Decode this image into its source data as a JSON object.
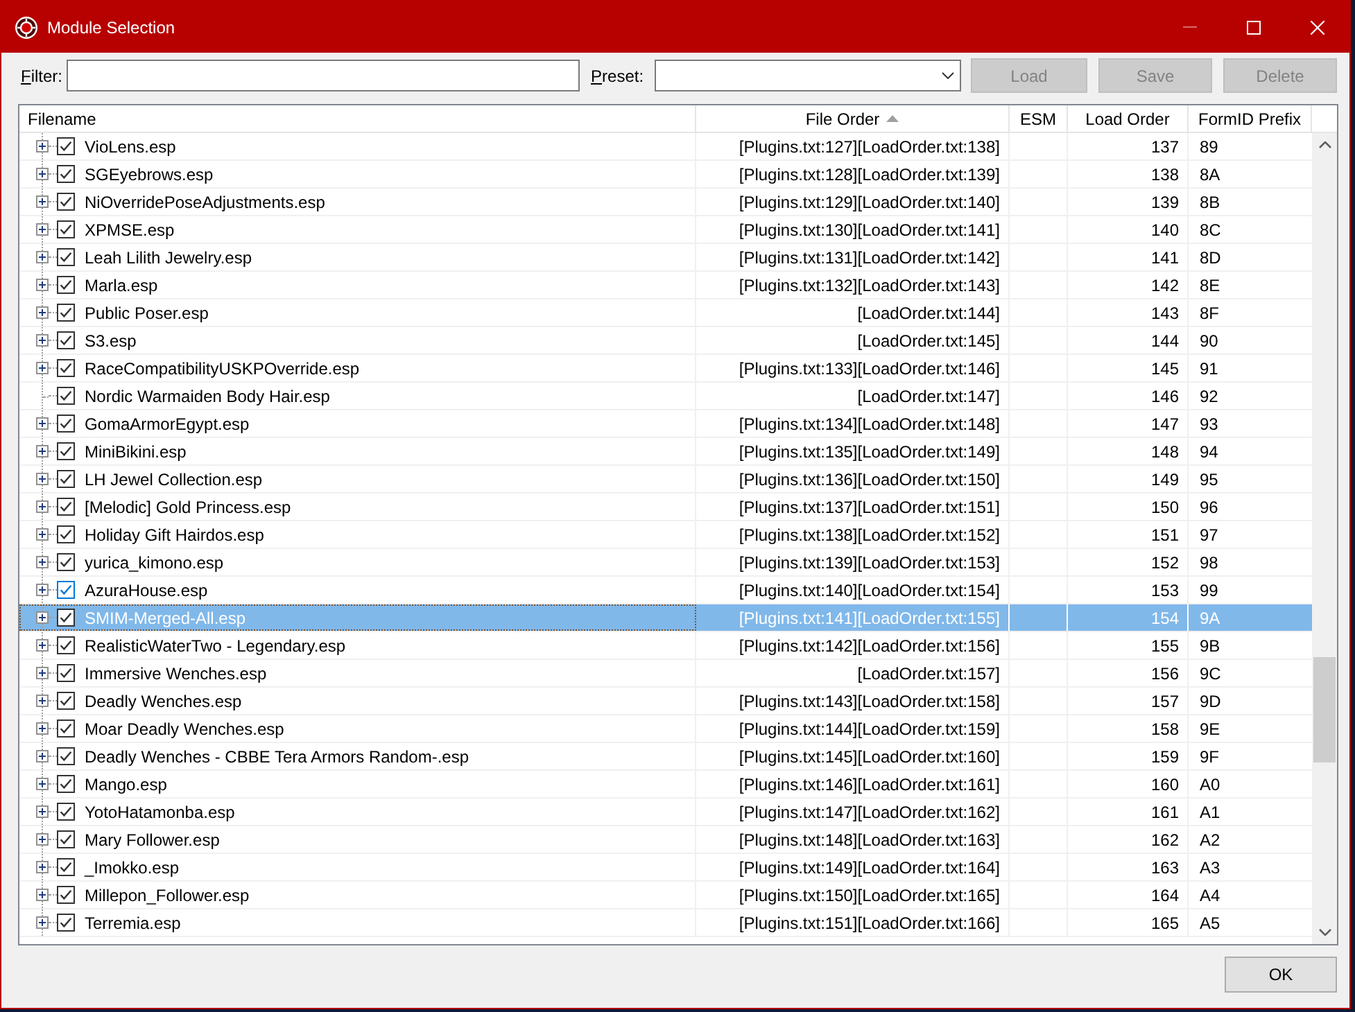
{
  "window": {
    "title": "Module Selection",
    "minimize_disabled": true
  },
  "filter": {
    "label": "Filter:"
  },
  "preset": {
    "label": "Preset:"
  },
  "buttons": [
    {
      "label": "Load",
      "disabled": true
    },
    {
      "label": "Save",
      "disabled": true
    },
    {
      "label": "Delete",
      "disabled": true
    }
  ],
  "table": {
    "columns": [
      {
        "label": "Filename",
        "sorted": false
      },
      {
        "label": "File Order",
        "sorted": true
      },
      {
        "label": "ESM",
        "sorted": false
      },
      {
        "label": "Load Order",
        "sorted": false
      },
      {
        "label": "FormID Prefix",
        "sorted": false
      }
    ],
    "rows": [
      {
        "filename": "VioLens.esp",
        "file_order": "[Plugins.txt:127][LoadOrder.txt:138]",
        "load_order": "137",
        "formid_prefix": "89",
        "checked": true,
        "expandable": true,
        "selected": false,
        "hovered": false
      },
      {
        "filename": "SGEyebrows.esp",
        "file_order": "[Plugins.txt:128][LoadOrder.txt:139]",
        "load_order": "138",
        "formid_prefix": "8A",
        "checked": true,
        "expandable": true,
        "selected": false,
        "hovered": false
      },
      {
        "filename": "NiOverridePoseAdjustments.esp",
        "file_order": "[Plugins.txt:129][LoadOrder.txt:140]",
        "load_order": "139",
        "formid_prefix": "8B",
        "checked": true,
        "expandable": true,
        "selected": false,
        "hovered": false
      },
      {
        "filename": "XPMSE.esp",
        "file_order": "[Plugins.txt:130][LoadOrder.txt:141]",
        "load_order": "140",
        "formid_prefix": "8C",
        "checked": true,
        "expandable": true,
        "selected": false,
        "hovered": false
      },
      {
        "filename": "Leah Lilith Jewelry.esp",
        "file_order": "[Plugins.txt:131][LoadOrder.txt:142]",
        "load_order": "141",
        "formid_prefix": "8D",
        "checked": true,
        "expandable": true,
        "selected": false,
        "hovered": false
      },
      {
        "filename": "Marla.esp",
        "file_order": "[Plugins.txt:132][LoadOrder.txt:143]",
        "load_order": "142",
        "formid_prefix": "8E",
        "checked": true,
        "expandable": true,
        "selected": false,
        "hovered": false
      },
      {
        "filename": "Public Poser.esp",
        "file_order": "[LoadOrder.txt:144]",
        "load_order": "143",
        "formid_prefix": "8F",
        "checked": true,
        "expandable": true,
        "selected": false,
        "hovered": false
      },
      {
        "filename": "S3.esp",
        "file_order": "[LoadOrder.txt:145]",
        "load_order": "144",
        "formid_prefix": "90",
        "checked": true,
        "expandable": true,
        "selected": false,
        "hovered": false
      },
      {
        "filename": "RaceCompatibilityUSKPOverride.esp",
        "file_order": "[Plugins.txt:133][LoadOrder.txt:146]",
        "load_order": "145",
        "formid_prefix": "91",
        "checked": true,
        "expandable": true,
        "selected": false,
        "hovered": false
      },
      {
        "filename": "Nordic Warmaiden Body Hair.esp",
        "file_order": "[LoadOrder.txt:147]",
        "load_order": "146",
        "formid_prefix": "92",
        "checked": true,
        "expandable": false,
        "selected": false,
        "hovered": false
      },
      {
        "filename": "GomaArmorEgypt.esp",
        "file_order": "[Plugins.txt:134][LoadOrder.txt:148]",
        "load_order": "147",
        "formid_prefix": "93",
        "checked": true,
        "expandable": true,
        "selected": false,
        "hovered": false
      },
      {
        "filename": "MiniBikini.esp",
        "file_order": "[Plugins.txt:135][LoadOrder.txt:149]",
        "load_order": "148",
        "formid_prefix": "94",
        "checked": true,
        "expandable": true,
        "selected": false,
        "hovered": false
      },
      {
        "filename": "LH Jewel Collection.esp",
        "file_order": "[Plugins.txt:136][LoadOrder.txt:150]",
        "load_order": "149",
        "formid_prefix": "95",
        "checked": true,
        "expandable": true,
        "selected": false,
        "hovered": false
      },
      {
        "filename": "[Melodic] Gold Princess.esp",
        "file_order": "[Plugins.txt:137][LoadOrder.txt:151]",
        "load_order": "150",
        "formid_prefix": "96",
        "checked": true,
        "expandable": true,
        "selected": false,
        "hovered": false
      },
      {
        "filename": "Holiday Gift Hairdos.esp",
        "file_order": "[Plugins.txt:138][LoadOrder.txt:152]",
        "load_order": "151",
        "formid_prefix": "97",
        "checked": true,
        "expandable": true,
        "selected": false,
        "hovered": false
      },
      {
        "filename": "yurica_kimono.esp",
        "file_order": "[Plugins.txt:139][LoadOrder.txt:153]",
        "load_order": "152",
        "formid_prefix": "98",
        "checked": true,
        "expandable": true,
        "selected": false,
        "hovered": false
      },
      {
        "filename": "AzuraHouse.esp",
        "file_order": "[Plugins.txt:140][LoadOrder.txt:154]",
        "load_order": "153",
        "formid_prefix": "99",
        "checked": true,
        "expandable": true,
        "selected": false,
        "hovered": true
      },
      {
        "filename": "SMIM-Merged-All.esp",
        "file_order": "[Plugins.txt:141][LoadOrder.txt:155]",
        "load_order": "154",
        "formid_prefix": "9A",
        "checked": true,
        "expandable": true,
        "selected": true,
        "hovered": false
      },
      {
        "filename": "RealisticWaterTwo - Legendary.esp",
        "file_order": "[Plugins.txt:142][LoadOrder.txt:156]",
        "load_order": "155",
        "formid_prefix": "9B",
        "checked": true,
        "expandable": true,
        "selected": false,
        "hovered": false
      },
      {
        "filename": "Immersive Wenches.esp",
        "file_order": "[LoadOrder.txt:157]",
        "load_order": "156",
        "formid_prefix": "9C",
        "checked": true,
        "expandable": true,
        "selected": false,
        "hovered": false
      },
      {
        "filename": "Deadly Wenches.esp",
        "file_order": "[Plugins.txt:143][LoadOrder.txt:158]",
        "load_order": "157",
        "formid_prefix": "9D",
        "checked": true,
        "expandable": true,
        "selected": false,
        "hovered": false
      },
      {
        "filename": "Moar Deadly Wenches.esp",
        "file_order": "[Plugins.txt:144][LoadOrder.txt:159]",
        "load_order": "158",
        "formid_prefix": "9E",
        "checked": true,
        "expandable": true,
        "selected": false,
        "hovered": false
      },
      {
        "filename": "Deadly Wenches - CBBE Tera Armors Random-.esp",
        "file_order": "[Plugins.txt:145][LoadOrder.txt:160]",
        "load_order": "159",
        "formid_prefix": "9F",
        "checked": true,
        "expandable": true,
        "selected": false,
        "hovered": false
      },
      {
        "filename": "Mango.esp",
        "file_order": "[Plugins.txt:146][LoadOrder.txt:161]",
        "load_order": "160",
        "formid_prefix": "A0",
        "checked": true,
        "expandable": true,
        "selected": false,
        "hovered": false
      },
      {
        "filename": "YotoHatamonba.esp",
        "file_order": "[Plugins.txt:147][LoadOrder.txt:162]",
        "load_order": "161",
        "formid_prefix": "A1",
        "checked": true,
        "expandable": true,
        "selected": false,
        "hovered": false
      },
      {
        "filename": "Mary Follower.esp",
        "file_order": "[Plugins.txt:148][LoadOrder.txt:163]",
        "load_order": "162",
        "formid_prefix": "A2",
        "checked": true,
        "expandable": true,
        "selected": false,
        "hovered": false
      },
      {
        "filename": "_Imokko.esp",
        "file_order": "[Plugins.txt:149][LoadOrder.txt:164]",
        "load_order": "163",
        "formid_prefix": "A3",
        "checked": true,
        "expandable": true,
        "selected": false,
        "hovered": false
      },
      {
        "filename": "Millepon_Follower.esp",
        "file_order": "[Plugins.txt:150][LoadOrder.txt:165]",
        "load_order": "164",
        "formid_prefix": "A4",
        "checked": true,
        "expandable": true,
        "selected": false,
        "hovered": false
      },
      {
        "filename": "Terremia.esp",
        "file_order": "[Plugins.txt:151][LoadOrder.txt:166]",
        "load_order": "165",
        "formid_prefix": "A5",
        "checked": true,
        "expandable": true,
        "selected": false,
        "hovered": false
      }
    ]
  },
  "ok_button": {
    "label": "OK"
  }
}
